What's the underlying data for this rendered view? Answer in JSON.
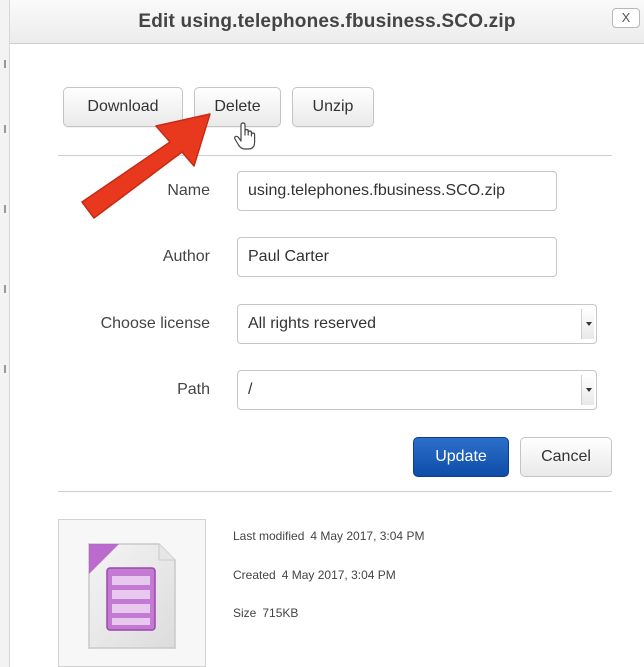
{
  "dialog": {
    "title": "Edit using.telephones.fbusiness.SCO.zip",
    "close_label": "X"
  },
  "actions": {
    "download_label": "Download",
    "delete_label": "Delete",
    "unzip_label": "Unzip"
  },
  "form": {
    "name_label": "Name",
    "name_value": "using.telephones.fbusiness.SCO.zip",
    "author_label": "Author",
    "author_value": "Paul Carter",
    "license_label": "Choose license",
    "license_value": "All rights reserved",
    "path_label": "Path",
    "path_value": "/"
  },
  "buttons": {
    "update_label": "Update",
    "cancel_label": "Cancel"
  },
  "file_info": {
    "last_modified_label": "Last modified",
    "last_modified_value": "4 May 2017, 3:04 PM",
    "created_label": "Created",
    "created_value": "4 May 2017, 3:04 PM",
    "size_label": "Size",
    "size_value": "715KB"
  },
  "annotation": {
    "arrow_color": "#e8391f",
    "icon": "mouse-pointer-hand-icon"
  },
  "colors": {
    "primary_button": "#1a56b3",
    "archive_icon": "#b45cc9"
  }
}
